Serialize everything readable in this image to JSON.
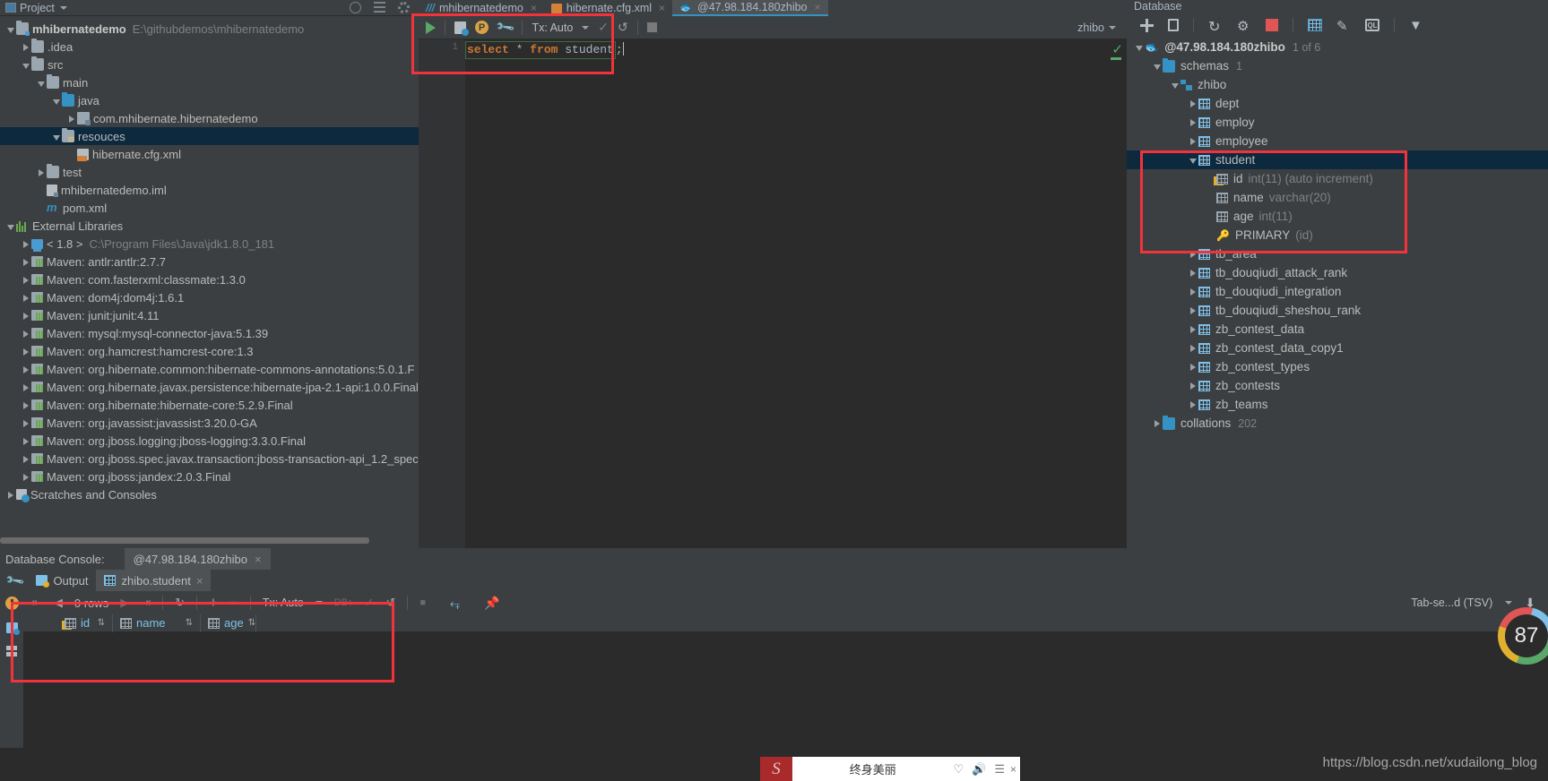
{
  "project_panel": {
    "header": {
      "title": "Project",
      "icons": [
        "globe-icon",
        "collapse-all-icon",
        "gear-icon"
      ]
    },
    "tree": [
      {
        "indent": 0,
        "twisty": "down",
        "icon": "folder-module-icon",
        "label": "mhibernatedemo",
        "bold": true,
        "sub": "E:\\githubdemos\\mhibernatedemo"
      },
      {
        "indent": 1,
        "twisty": "right",
        "icon": "folder-icon",
        "label": ".idea",
        "sub": ""
      },
      {
        "indent": 1,
        "twisty": "down",
        "icon": "folder-icon",
        "label": "src",
        "sub": ""
      },
      {
        "indent": 2,
        "twisty": "down",
        "icon": "folder-icon",
        "label": "main",
        "sub": ""
      },
      {
        "indent": 3,
        "twisty": "down",
        "icon": "folder-source-icon",
        "label": "java",
        "sub": ""
      },
      {
        "indent": 4,
        "twisty": "right",
        "icon": "package-icon",
        "label": "com.mhibernate.hibernatedemo",
        "sub": ""
      },
      {
        "indent": 3,
        "twisty": "down",
        "icon": "folder-resources-icon",
        "label": "resouces",
        "sub": "",
        "selected": true
      },
      {
        "indent": 4,
        "twisty": "none",
        "icon": "xml-file-icon",
        "label": "hibernate.cfg.xml",
        "sub": ""
      },
      {
        "indent": 2,
        "twisty": "right",
        "icon": "folder-icon",
        "label": "test",
        "sub": ""
      },
      {
        "indent": 2,
        "twisty": "none",
        "icon": "iml-file-icon",
        "label": "mhibernatedemo.iml",
        "sub": ""
      },
      {
        "indent": 2,
        "twisty": "none",
        "icon": "maven-pom-icon",
        "label": "pom.xml",
        "sub": ""
      },
      {
        "indent": 0,
        "twisty": "down",
        "icon": "external-libraries-icon",
        "label": "External Libraries",
        "sub": ""
      },
      {
        "indent": 1,
        "twisty": "right",
        "icon": "jdk-icon",
        "label": "< 1.8 >",
        "sub": "C:\\Program Files\\Java\\jdk1.8.0_181"
      },
      {
        "indent": 1,
        "twisty": "right",
        "icon": "maven-lib-icon",
        "label": "Maven: antlr:antlr:2.7.7",
        "sub": ""
      },
      {
        "indent": 1,
        "twisty": "right",
        "icon": "maven-lib-icon",
        "label": "Maven: com.fasterxml:classmate:1.3.0",
        "sub": ""
      },
      {
        "indent": 1,
        "twisty": "right",
        "icon": "maven-lib-icon",
        "label": "Maven: dom4j:dom4j:1.6.1",
        "sub": ""
      },
      {
        "indent": 1,
        "twisty": "right",
        "icon": "maven-lib-icon",
        "label": "Maven: junit:junit:4.11",
        "sub": ""
      },
      {
        "indent": 1,
        "twisty": "right",
        "icon": "maven-lib-icon",
        "label": "Maven: mysql:mysql-connector-java:5.1.39",
        "sub": ""
      },
      {
        "indent": 1,
        "twisty": "right",
        "icon": "maven-lib-icon",
        "label": "Maven: org.hamcrest:hamcrest-core:1.3",
        "sub": ""
      },
      {
        "indent": 1,
        "twisty": "right",
        "icon": "maven-lib-icon",
        "label": "Maven: org.hibernate.common:hibernate-commons-annotations:5.0.1.F",
        "sub": ""
      },
      {
        "indent": 1,
        "twisty": "right",
        "icon": "maven-lib-icon",
        "label": "Maven: org.hibernate.javax.persistence:hibernate-jpa-2.1-api:1.0.0.Final",
        "sub": ""
      },
      {
        "indent": 1,
        "twisty": "right",
        "icon": "maven-lib-icon",
        "label": "Maven: org.hibernate:hibernate-core:5.2.9.Final",
        "sub": ""
      },
      {
        "indent": 1,
        "twisty": "right",
        "icon": "maven-lib-icon",
        "label": "Maven: org.javassist:javassist:3.20.0-GA",
        "sub": ""
      },
      {
        "indent": 1,
        "twisty": "right",
        "icon": "maven-lib-icon",
        "label": "Maven: org.jboss.logging:jboss-logging:3.3.0.Final",
        "sub": ""
      },
      {
        "indent": 1,
        "twisty": "right",
        "icon": "maven-lib-icon",
        "label": "Maven: org.jboss.spec.javax.transaction:jboss-transaction-api_1.2_spec",
        "sub": ""
      },
      {
        "indent": 1,
        "twisty": "right",
        "icon": "maven-lib-icon",
        "label": "Maven: org.jboss:jandex:2.0.3.Final",
        "sub": ""
      },
      {
        "indent": 0,
        "twisty": "right",
        "icon": "scratches-icon",
        "label": "Scratches and Consoles",
        "sub": ""
      }
    ]
  },
  "editor": {
    "tabs": [
      {
        "label": "mhibernatedemo",
        "icon": "module-icon",
        "active": false,
        "closable": true
      },
      {
        "label": "hibernate.cfg.xml",
        "icon": "xml-file-icon",
        "active": false,
        "closable": true
      },
      {
        "label": "@47.98.184.180zhibo",
        "icon": "database-console-icon",
        "active": true,
        "closable": true
      }
    ],
    "toolbar": {
      "run_label": "run-icon",
      "history_label": "sql-history-icon",
      "param_label": "P",
      "settings_label": "wrench-icon",
      "tx_label": "Tx: Auto",
      "commit_label": "commit-icon",
      "rollback_label": "rollback-icon",
      "stop_label": "stop-icon",
      "db_select": "zhibo"
    },
    "code": {
      "line_number": "1",
      "keyword1": "select",
      "star": " * ",
      "keyword2": "from",
      "table": " student",
      "semicolon": ";"
    }
  },
  "database_panel": {
    "title": "Database",
    "toolbar": [
      "plus-icon",
      "copy-icon",
      "refresh-icon",
      "sync-icon",
      "stop-icon",
      "table-editor-icon",
      "modify-icon",
      "query-console-icon",
      "filter-icon"
    ],
    "tree": [
      {
        "indent": 0,
        "twisty": "down",
        "icon": "db-connection-icon",
        "label": "@47.98.184.180zhibo",
        "bold": true,
        "meta": "1 of 6",
        "type": ""
      },
      {
        "indent": 1,
        "twisty": "down",
        "icon": "folder-icon",
        "label": "schemas",
        "meta": "1",
        "type": ""
      },
      {
        "indent": 2,
        "twisty": "down",
        "icon": "schema-icon",
        "label": "zhibo",
        "meta": "",
        "type": ""
      },
      {
        "indent": 3,
        "twisty": "right",
        "icon": "table-icon",
        "label": "dept",
        "meta": "",
        "type": ""
      },
      {
        "indent": 3,
        "twisty": "right",
        "icon": "table-icon",
        "label": "employ",
        "meta": "",
        "type": ""
      },
      {
        "indent": 3,
        "twisty": "right",
        "icon": "table-icon",
        "label": "employee",
        "meta": "",
        "type": ""
      },
      {
        "indent": 3,
        "twisty": "down",
        "icon": "table-icon",
        "label": "student",
        "meta": "",
        "type": "",
        "selected": true
      },
      {
        "indent": 4,
        "twisty": "none",
        "icon": "primary-column-icon",
        "label": "id",
        "meta": "",
        "type": "int(11) (auto increment)"
      },
      {
        "indent": 4,
        "twisty": "none",
        "icon": "column-icon",
        "label": "name",
        "meta": "",
        "type": "varchar(20)"
      },
      {
        "indent": 4,
        "twisty": "none",
        "icon": "column-icon",
        "label": "age",
        "meta": "",
        "type": "int(11)"
      },
      {
        "indent": 4,
        "twisty": "none",
        "icon": "key-icon",
        "label": "PRIMARY",
        "meta": "",
        "type": "(id)"
      },
      {
        "indent": 3,
        "twisty": "right",
        "icon": "table-icon",
        "label": "tb_area",
        "meta": "",
        "type": ""
      },
      {
        "indent": 3,
        "twisty": "right",
        "icon": "table-icon",
        "label": "tb_douqiudi_attack_rank",
        "meta": "",
        "type": ""
      },
      {
        "indent": 3,
        "twisty": "right",
        "icon": "table-icon",
        "label": "tb_douqiudi_integration",
        "meta": "",
        "type": ""
      },
      {
        "indent": 3,
        "twisty": "right",
        "icon": "table-icon",
        "label": "tb_douqiudi_sheshou_rank",
        "meta": "",
        "type": ""
      },
      {
        "indent": 3,
        "twisty": "right",
        "icon": "table-icon",
        "label": "zb_contest_data",
        "meta": "",
        "type": ""
      },
      {
        "indent": 3,
        "twisty": "right",
        "icon": "table-icon",
        "label": "zb_contest_data_copy1",
        "meta": "",
        "type": ""
      },
      {
        "indent": 3,
        "twisty": "right",
        "icon": "table-icon",
        "label": "zb_contest_types",
        "meta": "",
        "type": ""
      },
      {
        "indent": 3,
        "twisty": "right",
        "icon": "table-icon",
        "label": "zb_contests",
        "meta": "",
        "type": ""
      },
      {
        "indent": 3,
        "twisty": "right",
        "icon": "table-icon",
        "label": "zb_teams",
        "meta": "",
        "type": ""
      },
      {
        "indent": 1,
        "twisty": "right",
        "icon": "folder-icon",
        "label": "collations",
        "meta": "202",
        "type": ""
      }
    ]
  },
  "console": {
    "label": "Database Console:",
    "connection": "@47.98.184.180zhibo",
    "tabs": [
      {
        "label": "Output",
        "icon": "output-icon",
        "active": false
      },
      {
        "label": "zhibo.student",
        "icon": "table-icon",
        "active": true,
        "closable": true
      }
    ]
  },
  "results": {
    "toolbar": {
      "first_label": "first-page-icon",
      "prev_label": "prev-page-icon",
      "rows": "0 rows",
      "next_label": "next-page-icon",
      "last_label": "last-page-icon",
      "reload_label": "reload-icon",
      "add_label": "add-row-icon",
      "remove_label": "remove-row-icon",
      "tx": "Tx: Auto",
      "submit_label": "submit-db-icon",
      "commit_label": "commit-icon",
      "revert_label": "revert-icon",
      "stop_label": "stop-icon",
      "transpose_label": "transpose-icon",
      "pin_label": "pin-icon",
      "format": "Tab-se...d (TSV)",
      "export_label": "export-icon"
    },
    "columns": [
      {
        "name": "id",
        "icon": "primary-key-icon"
      },
      {
        "name": "name",
        "icon": "column-icon"
      },
      {
        "name": "age",
        "icon": "column-icon"
      }
    ],
    "rows": []
  },
  "gauge": {
    "value": "87"
  },
  "music_popup": {
    "cover_letter": "S",
    "title": "终身美丽",
    "controls": [
      "heart-icon",
      "volume-icon",
      "playlist-icon"
    ],
    "close": "×"
  },
  "watermark": "https://blog.csdn.net/xudailong_blog",
  "colors": {
    "accent_blue": "#3592c4",
    "selection": "#0d293e",
    "highlight_red": "#f1333c",
    "keyword_orange": "#cc7832",
    "run_green": "#59a869"
  }
}
